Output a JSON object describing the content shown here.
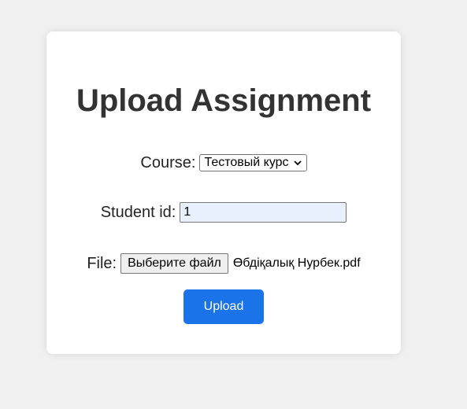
{
  "form": {
    "title": "Upload Assignment",
    "course_label": "Course:",
    "course_selected": "Тестовый курс",
    "student_label": "Student id:",
    "student_value": "1",
    "file_label": "File:",
    "file_button_label": "Выберите файл",
    "file_name": "Өбдіқалық Нурбек.pdf",
    "submit_label": "Upload"
  },
  "colors": {
    "background": "#f0f0f0",
    "card": "#ffffff",
    "accent": "#1a73e8",
    "autofill": "#e8f0fe"
  },
  "icons": {
    "select_arrow": "chevron-down-icon"
  }
}
